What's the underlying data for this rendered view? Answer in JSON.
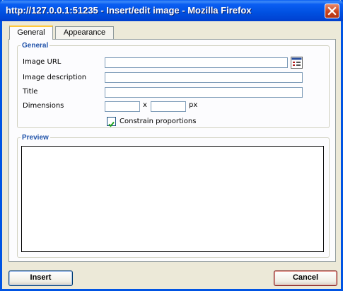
{
  "window": {
    "title": "http://127.0.0.1:51235 - Insert/edit image - Mozilla Firefox",
    "close_icon": "close-icon"
  },
  "tabs": [
    {
      "label": "General",
      "active": true
    },
    {
      "label": "Appearance",
      "active": false
    }
  ],
  "general": {
    "legend": "General",
    "image_url_label": "Image URL",
    "image_url_value": "",
    "browse_icon": "file-browser-icon",
    "image_description_label": "Image description",
    "image_description_value": "",
    "title_label": "Title",
    "title_value": "",
    "dimensions_label": "Dimensions",
    "width_value": "",
    "height_value": "",
    "dimension_separator": "x",
    "dimension_unit": "px",
    "constrain_label": "Constrain proportions",
    "constrain_checked": true
  },
  "preview": {
    "legend": "Preview"
  },
  "buttons": {
    "insert_label": "Insert",
    "cancel_label": "Cancel"
  },
  "colors": {
    "titlebar": "#0054e3",
    "legend_text": "#2153aa",
    "dialog_bg": "#ece9d8",
    "close_button": "#c9431c",
    "tab_highlight": "#ffc83c"
  }
}
